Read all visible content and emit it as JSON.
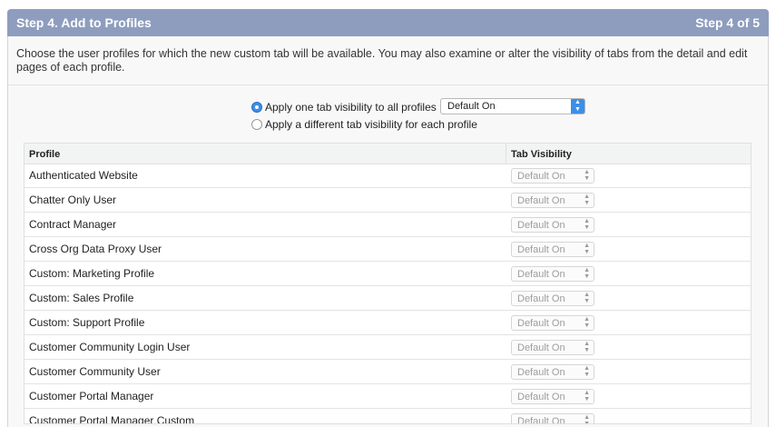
{
  "header": {
    "title": "Step 4. Add to Profiles",
    "step": "Step 4 of 5"
  },
  "description": "Choose the user profiles for which the new custom tab will be available. You may also examine or alter the visibility of tabs from the detail and edit pages of each profile.",
  "options": {
    "apply_all_label": "Apply one tab visibility to all profiles",
    "apply_each_label": "Apply a different tab visibility for each profile",
    "selected": "apply_all",
    "visibility_value": "Default On"
  },
  "table": {
    "columns": [
      "Profile",
      "Tab Visibility"
    ],
    "rows": [
      {
        "profile": "Authenticated Website",
        "visibility": "Default On"
      },
      {
        "profile": "Chatter Only User",
        "visibility": "Default On"
      },
      {
        "profile": "Contract Manager",
        "visibility": "Default On"
      },
      {
        "profile": "Cross Org Data Proxy User",
        "visibility": "Default On"
      },
      {
        "profile": "Custom: Marketing Profile",
        "visibility": "Default On"
      },
      {
        "profile": "Custom: Sales Profile",
        "visibility": "Default On"
      },
      {
        "profile": "Custom: Support Profile",
        "visibility": "Default On"
      },
      {
        "profile": "Customer Community Login User",
        "visibility": "Default On"
      },
      {
        "profile": "Customer Community User",
        "visibility": "Default On"
      },
      {
        "profile": "Customer Portal Manager",
        "visibility": "Default On"
      },
      {
        "profile": "Customer Portal Manager Custom",
        "visibility": "Default On"
      }
    ]
  },
  "colors": {
    "header_bg": "#8e9dbe",
    "accent": "#3d8ee8"
  }
}
